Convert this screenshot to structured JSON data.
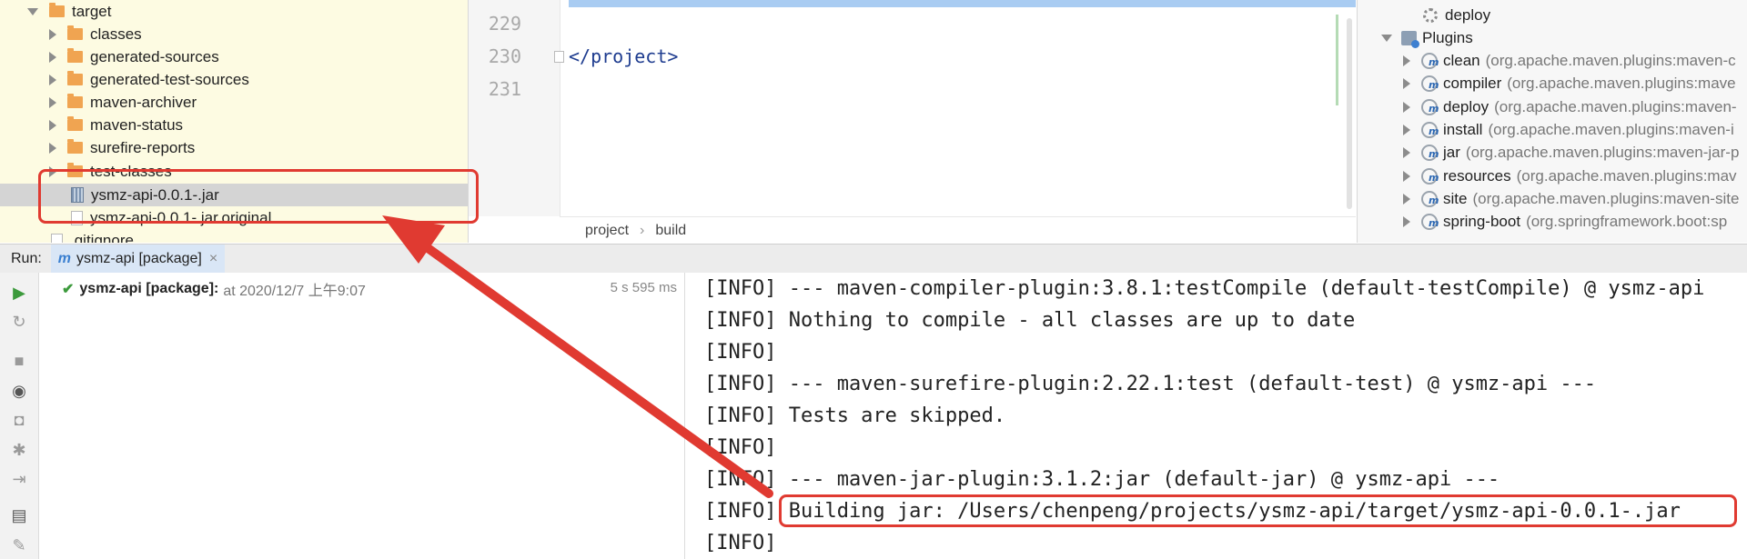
{
  "project_tree": {
    "items": [
      {
        "label": "target",
        "kind": "folder",
        "expanded": true
      },
      {
        "label": "classes",
        "kind": "folder",
        "expanded": false
      },
      {
        "label": "generated-sources",
        "kind": "folder",
        "expanded": false
      },
      {
        "label": "generated-test-sources",
        "kind": "folder",
        "expanded": false
      },
      {
        "label": "maven-archiver",
        "kind": "folder",
        "expanded": false
      },
      {
        "label": "maven-status",
        "kind": "folder",
        "expanded": false
      },
      {
        "label": "surefire-reports",
        "kind": "folder",
        "expanded": false
      },
      {
        "label": "test-classes",
        "kind": "folder",
        "expanded": false
      },
      {
        "label": "ysmz-api-0.0.1-.jar",
        "kind": "jar",
        "selected": true
      },
      {
        "label": "ysmz-api-0.0.1-.jar.original",
        "kind": "file"
      },
      {
        "label": ".gitignore",
        "kind": "file"
      }
    ],
    "colors": {
      "folder": "#f0a451",
      "background": "#fdfbe2",
      "selected": "#d4d4d4"
    }
  },
  "editor": {
    "line_numbers": [
      "229",
      "230",
      "231"
    ],
    "code": [
      "",
      "</project>",
      ""
    ],
    "breadcrumb": [
      "project",
      "build"
    ]
  },
  "maven": {
    "deploy_label": "deploy",
    "plugins_label": "Plugins",
    "plugins": [
      {
        "name": "clean",
        "detail": "(org.apache.maven.plugins:maven-c"
      },
      {
        "name": "compiler",
        "detail": "(org.apache.maven.plugins:mave"
      },
      {
        "name": "deploy",
        "detail": "(org.apache.maven.plugins:maven-"
      },
      {
        "name": "install",
        "detail": "(org.apache.maven.plugins:maven-i"
      },
      {
        "name": "jar",
        "detail": "(org.apache.maven.plugins:maven-jar-p"
      },
      {
        "name": "resources",
        "detail": "(org.apache.maven.plugins:mav"
      },
      {
        "name": "site",
        "detail": "(org.apache.maven.plugins:maven-site"
      },
      {
        "name": "spring-boot",
        "detail": "(org.springframework.boot:sp"
      }
    ]
  },
  "run": {
    "label": "Run:",
    "tab_label": "ysmz-api [package]",
    "tab_close": "×",
    "tree_item": {
      "title": "ysmz-api [package]:",
      "detail": "at 2020/12/7 上午9:07",
      "duration": "5 s 595 ms"
    },
    "toolbar_icons": [
      "rerun-icon",
      "rerun-failed-icon",
      "stop-icon",
      "eye-icon",
      "camera-icon",
      "settings-icon",
      "export-icon",
      "layout-icon",
      "pin-icon"
    ],
    "console_lines": [
      "[INFO] --- maven-compiler-plugin:3.8.1:testCompile (default-testCompile) @ ysmz-api",
      "[INFO] Nothing to compile - all classes are up to date",
      "[INFO]",
      "[INFO] --- maven-surefire-plugin:2.22.1:test (default-test) @ ysmz-api ---",
      "[INFO] Tests are skipped.",
      "[INFO]",
      "[INFO] --- maven-jar-plugin:3.1.2:jar (default-jar) @ ysmz-api ---",
      "[INFO] Building jar: /Users/chenpeng/projects/ysmz-api/target/ysmz-api-0.0.1-.jar",
      "[INFO]"
    ]
  },
  "annotation_color": "#e03a31"
}
